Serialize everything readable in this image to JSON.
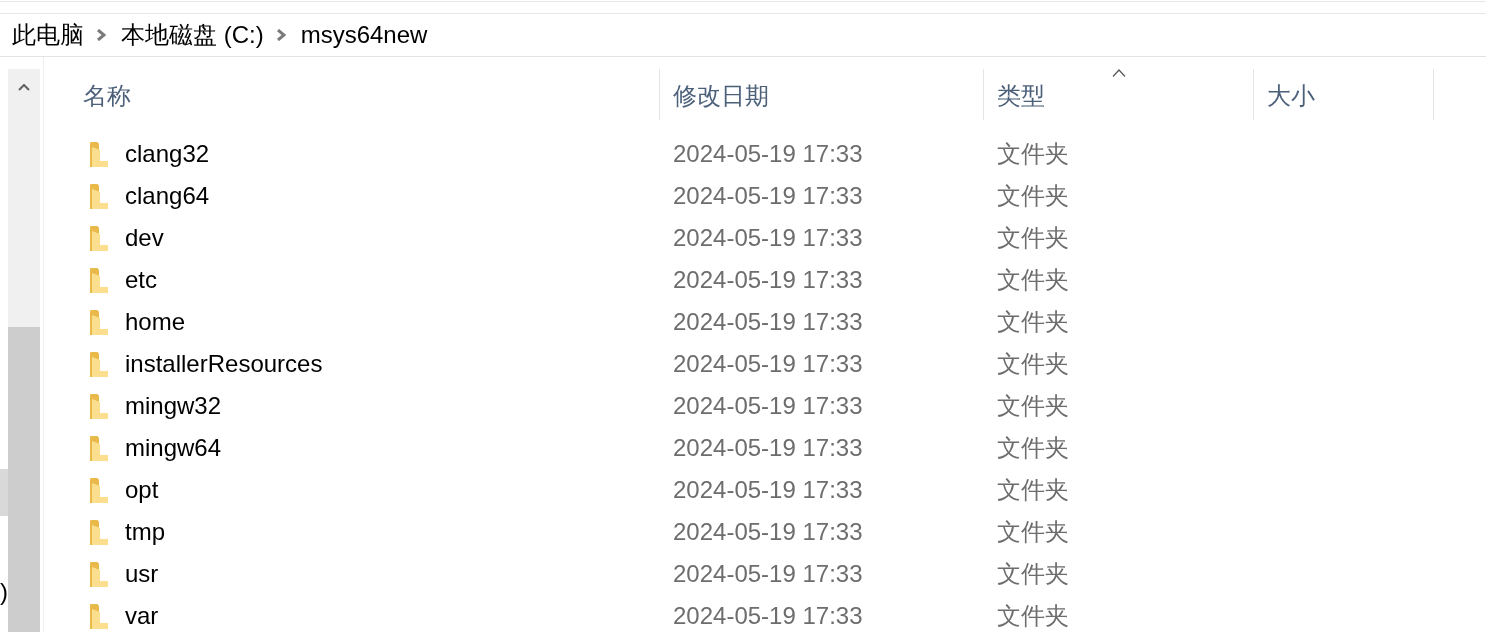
{
  "breadcrumb": [
    {
      "label": "此电脑"
    },
    {
      "label": "本地磁盘 (C:)"
    },
    {
      "label": "msys64new"
    }
  ],
  "nav_pane": {
    "items": [
      {
        "selected": true
      },
      {
        "label": ")",
        "selected": false
      }
    ]
  },
  "table": {
    "columns": [
      {
        "label": "名称",
        "sorted": false
      },
      {
        "label": "修改日期",
        "sorted": false
      },
      {
        "label": "类型",
        "sorted": true
      },
      {
        "label": "大小",
        "sorted": false
      }
    ],
    "rows": [
      {
        "name": "clang32",
        "modified": "2024-05-19 17:33",
        "type": "文件夹",
        "selected": false
      },
      {
        "name": "clang64",
        "modified": "2024-05-19 17:33",
        "type": "文件夹",
        "selected": false
      },
      {
        "name": "dev",
        "modified": "2024-05-19 17:33",
        "type": "文件夹",
        "selected": false
      },
      {
        "name": "etc",
        "modified": "2024-05-19 17:33",
        "type": "文件夹",
        "selected": false
      },
      {
        "name": "home",
        "modified": "2024-05-19 17:33",
        "type": "文件夹",
        "selected": false
      },
      {
        "name": "installerResources",
        "modified": "2024-05-19 17:33",
        "type": "文件夹",
        "selected": false
      },
      {
        "name": "mingw32",
        "modified": "2024-05-19 17:33",
        "type": "文件夹",
        "selected": false
      },
      {
        "name": "mingw64",
        "modified": "2024-05-19 17:33",
        "type": "文件夹",
        "selected": false
      },
      {
        "name": "opt",
        "modified": "2024-05-19 17:33",
        "type": "文件夹",
        "selected": false
      },
      {
        "name": "tmp",
        "modified": "2024-05-19 17:33",
        "type": "文件夹",
        "selected": false
      },
      {
        "name": "usr",
        "modified": "2024-05-19 17:33",
        "type": "文件夹",
        "selected": false
      },
      {
        "name": "var",
        "modified": "2024-05-19 17:33",
        "type": "文件夹",
        "selected": false
      }
    ]
  }
}
